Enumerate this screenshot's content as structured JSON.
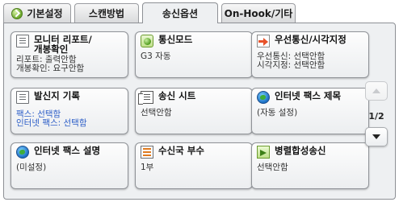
{
  "tabs": [
    {
      "label": "기본설정",
      "active": false,
      "icon": "check-circle-icon"
    },
    {
      "label": "스캔방법",
      "active": false
    },
    {
      "label": "송신옵션",
      "active": true
    },
    {
      "label": "On-Hook/기타",
      "active": false
    }
  ],
  "buttons": {
    "monitor_report": {
      "title": "모니터 리포트/\n개봉확인",
      "value": "리포트: 출력안함\n개봉확인: 요구안함",
      "icon": "document-icon"
    },
    "comm_mode": {
      "title": "통신모드",
      "value": "G3 자동",
      "icon": "green-circle-icon"
    },
    "priority_send": {
      "title": "우선통신/시각지정",
      "value": "우선통신: 선택안함\n시각지정: 선택안함",
      "icon": "arrow-right-icon"
    },
    "sender_record": {
      "title": "발신지 기록",
      "value": "팩스: 선택함\n인터넷 팩스: 선택함",
      "icon": "document-icon"
    },
    "send_sheet": {
      "title": "송신 시트",
      "value": "선택안함",
      "icon": "sheet-icon"
    },
    "ifax_subject": {
      "title": "인터넷 팩스 제목",
      "value": "(자동 설정)",
      "icon": "globe-icon"
    },
    "ifax_desc": {
      "title": "인터넷 팩스 설명",
      "value": "(미설정)",
      "icon": "globe-icon"
    },
    "recipient_copies": {
      "title": "수신국 부수",
      "value": "1부",
      "icon": "list-icon"
    },
    "parallel_send": {
      "title": "병렬합성송신",
      "value": "선택안함",
      "icon": "play-icon"
    }
  },
  "pager": {
    "indicator": "1/2"
  },
  "colors": {
    "accent_blue": "#2f60c8",
    "panel": "#eef0f2",
    "border": "#8d9095"
  }
}
